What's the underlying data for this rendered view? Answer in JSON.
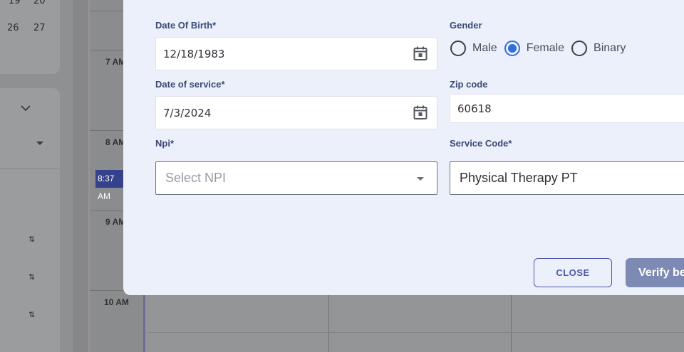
{
  "background": {
    "mini_calendar_days": [
      "19",
      "20",
      "26",
      "27"
    ],
    "hours": [
      "7 AM",
      "8 AM",
      "9 AM",
      "10 AM"
    ],
    "current_time": "8:37 AM",
    "sort_icons": [
      "⇅",
      "⇅",
      "⇅"
    ]
  },
  "modal": {
    "dob": {
      "label": "Date Of Birth*",
      "value": "12/18/1983"
    },
    "gender": {
      "label": "Gender",
      "options": [
        "Male",
        "Female",
        "Binary"
      ],
      "selected": "Female"
    },
    "dos": {
      "label": "Date of service*",
      "value": "7/3/2024"
    },
    "zip": {
      "label": "Zip code",
      "value": "60618"
    },
    "npi": {
      "label": "Npi*",
      "placeholder": "Select NPI"
    },
    "service_code": {
      "label": "Service Code*",
      "value": "Physical Therapy PT"
    },
    "buttons": {
      "close": "CLOSE",
      "verify": "Verify benefits"
    }
  },
  "colors": {
    "accent": "#2f6fe0",
    "primary": "#4c58a8",
    "verify_button": "#7c8ab4",
    "now_badge": "#35418a"
  }
}
